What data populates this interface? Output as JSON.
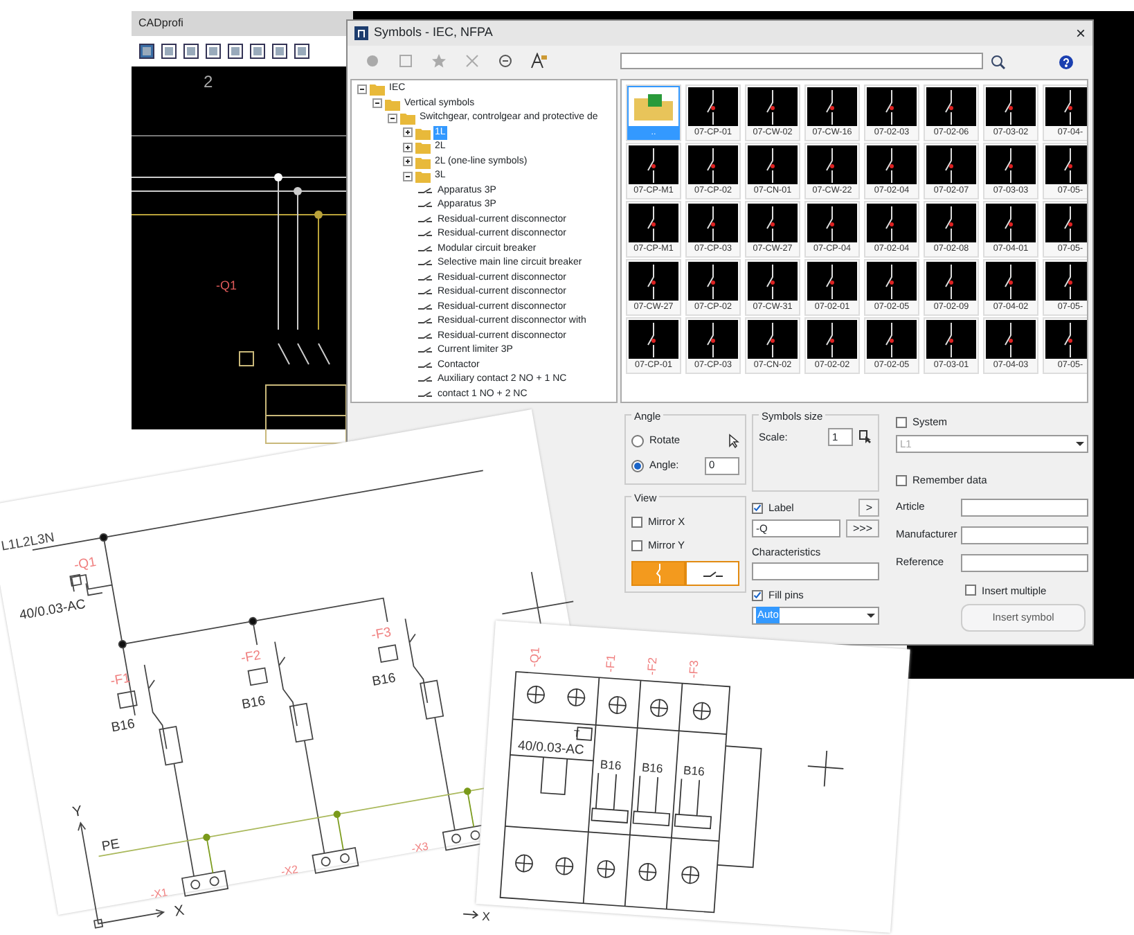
{
  "cad_window": {
    "title": "CADprofi",
    "ruler_label": "2",
    "tag": "-Q1"
  },
  "dialog": {
    "title": "Symbols - IEC, NFPA",
    "close": "×",
    "tree": [
      {
        "label": "IEC",
        "expanded": true,
        "selected": false,
        "children": [
          {
            "label": "Vertical symbols",
            "expanded": true,
            "selected": false,
            "children": [
              {
                "label": "Switchgear, controlgear and protective de",
                "expanded": true,
                "selected": false,
                "children": [
                  {
                    "label": "1L",
                    "expanded": false,
                    "selected": true
                  },
                  {
                    "label": "2L",
                    "expanded": false,
                    "selected": false
                  },
                  {
                    "label": "2L (one-line symbols)",
                    "expanded": false,
                    "selected": false
                  },
                  {
                    "label": "3L",
                    "expanded": true,
                    "selected": false,
                    "children": [
                      {
                        "label": "Apparatus 3P",
                        "selected": false
                      },
                      {
                        "label": "Apparatus 3P",
                        "selected": false
                      },
                      {
                        "label": "Residual-current disconnector",
                        "selected": false
                      },
                      {
                        "label": "Residual-current disconnector",
                        "selected": false
                      },
                      {
                        "label": "Modular circuit breaker",
                        "selected": false
                      },
                      {
                        "label": "Selective main line circuit breaker",
                        "selected": false
                      },
                      {
                        "label": "Residual-current disconnector",
                        "selected": false
                      },
                      {
                        "label": "Residual-current disconnector",
                        "selected": false
                      },
                      {
                        "label": "Residual-current disconnector",
                        "selected": false
                      },
                      {
                        "label": "Residual-current disconnector with",
                        "selected": false
                      },
                      {
                        "label": "Residual-current disconnector",
                        "selected": false
                      },
                      {
                        "label": "Current limiter 3P",
                        "selected": false
                      },
                      {
                        "label": "Contactor",
                        "selected": false
                      },
                      {
                        "label": "Auxiliary contact 2 NO + 1 NC",
                        "selected": false
                      },
                      {
                        "label": "contact 1 NO + 2 NC",
                        "selected": false
                      }
                    ]
                  }
                ]
              }
            ]
          }
        ]
      }
    ],
    "symbols": [
      {
        "label": "..",
        "kind": "folder",
        "selected": true
      },
      {
        "label": "07-CP-01",
        "kind": "symbol",
        "selected": false
      },
      {
        "label": "07-CW-02",
        "kind": "symbol",
        "selected": false
      },
      {
        "label": "07-CW-16",
        "kind": "symbol",
        "selected": false
      },
      {
        "label": "07-02-03",
        "kind": "symbol",
        "selected": false
      },
      {
        "label": "07-02-06",
        "kind": "symbol",
        "selected": false
      },
      {
        "label": "07-03-02",
        "kind": "symbol",
        "selected": false
      },
      {
        "label": "07-04-",
        "kind": "symbol",
        "selected": false
      },
      {
        "label": "07-CP-M1",
        "kind": "symbol",
        "selected": false
      },
      {
        "label": "07-CP-02",
        "kind": "symbol",
        "selected": false
      },
      {
        "label": "07-CN-01",
        "kind": "symbol",
        "selected": false
      },
      {
        "label": "07-CW-22",
        "kind": "symbol",
        "selected": false
      },
      {
        "label": "07-02-04",
        "kind": "symbol",
        "selected": false
      },
      {
        "label": "07-02-07",
        "kind": "symbol",
        "selected": false
      },
      {
        "label": "07-03-03",
        "kind": "symbol",
        "selected": false
      },
      {
        "label": "07-05-",
        "kind": "symbol",
        "selected": false
      },
      {
        "label": "07-CP-M1",
        "kind": "symbol",
        "selected": false
      },
      {
        "label": "07-CP-03",
        "kind": "symbol",
        "selected": false
      },
      {
        "label": "07-CW-27",
        "kind": "symbol",
        "selected": false
      },
      {
        "label": "07-CP-04",
        "kind": "symbol",
        "selected": false
      },
      {
        "label": "07-02-04",
        "kind": "symbol",
        "selected": false
      },
      {
        "label": "07-02-08",
        "kind": "symbol",
        "selected": false
      },
      {
        "label": "07-04-01",
        "kind": "symbol",
        "selected": false
      },
      {
        "label": "07-05-",
        "kind": "symbol",
        "selected": false
      },
      {
        "label": "07-CW-27",
        "kind": "symbol",
        "selected": false
      },
      {
        "label": "07-CP-02",
        "kind": "symbol",
        "selected": false
      },
      {
        "label": "07-CW-31",
        "kind": "symbol",
        "selected": false
      },
      {
        "label": "07-02-01",
        "kind": "symbol",
        "selected": false
      },
      {
        "label": "07-02-05",
        "kind": "symbol",
        "selected": false
      },
      {
        "label": "07-02-09",
        "kind": "symbol",
        "selected": false
      },
      {
        "label": "07-04-02",
        "kind": "symbol",
        "selected": false
      },
      {
        "label": "07-05-",
        "kind": "symbol",
        "selected": false
      },
      {
        "label": "07-CP-01",
        "kind": "symbol",
        "selected": false
      },
      {
        "label": "07-CP-03",
        "kind": "symbol",
        "selected": false
      },
      {
        "label": "07-CN-02",
        "kind": "symbol",
        "selected": false
      },
      {
        "label": "07-02-02",
        "kind": "symbol",
        "selected": false
      },
      {
        "label": "07-02-05",
        "kind": "symbol",
        "selected": false
      },
      {
        "label": "07-03-01",
        "kind": "symbol",
        "selected": false
      },
      {
        "label": "07-04-03",
        "kind": "symbol",
        "selected": false
      },
      {
        "label": "07-05-",
        "kind": "symbol",
        "selected": false
      }
    ],
    "angle": {
      "title": "Angle",
      "options": [
        {
          "label": "Rotate",
          "selected": false
        },
        {
          "label": "Angle:",
          "selected": true
        }
      ],
      "value": "0"
    },
    "size": {
      "title": "Symbols size",
      "scale_label": "Scale:",
      "value": "1"
    },
    "view": {
      "title": "View",
      "mirrors": [
        {
          "label": "Mirror X",
          "checked": false
        },
        {
          "label": "Mirror Y",
          "checked": false
        }
      ],
      "orientation": [
        {
          "selected": true
        },
        {
          "selected": false
        }
      ]
    },
    "label": {
      "label": "Label",
      "checked": true,
      "value": "-Q",
      "buttons": [
        ">",
        ">>>"
      ]
    },
    "characteristics": {
      "label": "Characteristics"
    },
    "fill_pins": {
      "label": "Fill pins",
      "checked": true,
      "value": "Auto"
    },
    "system": {
      "label": "System",
      "checked": false,
      "value": "L1",
      "disabled": true
    },
    "remember": {
      "label": "Remember data",
      "checked": false
    },
    "fields": [
      {
        "label": "Article"
      },
      {
        "label": "Manufacturer"
      },
      {
        "label": "Reference"
      }
    ],
    "insert_multiple": {
      "label": "Insert multiple",
      "checked": false
    },
    "insert_button": {
      "label": "Insert symbol",
      "disabled": true
    }
  },
  "schematic": {
    "bus_label": "L1L2L3N",
    "main": {
      "tag": "-Q1",
      "rating": "40/0.03-AC"
    },
    "breakers": [
      {
        "tag": "-F1",
        "rating": "B16",
        "terminal": "-X1"
      },
      {
        "tag": "-F2",
        "rating": "B16",
        "terminal": "-X2"
      },
      {
        "tag": "-F3",
        "rating": "B16",
        "terminal": "-X3"
      }
    ],
    "pe_label": "PE",
    "axis_y": "Y",
    "axis_x": "X"
  },
  "panel": {
    "main": {
      "tag": "-Q1",
      "rating": "40/0.03-AC",
      "test": "T"
    },
    "breakers": [
      {
        "tag": "-F1",
        "rating": "B16"
      },
      {
        "tag": "-F2",
        "rating": "B16"
      },
      {
        "tag": "-F3",
        "rating": "B16"
      }
    ],
    "axis_x": "X"
  }
}
